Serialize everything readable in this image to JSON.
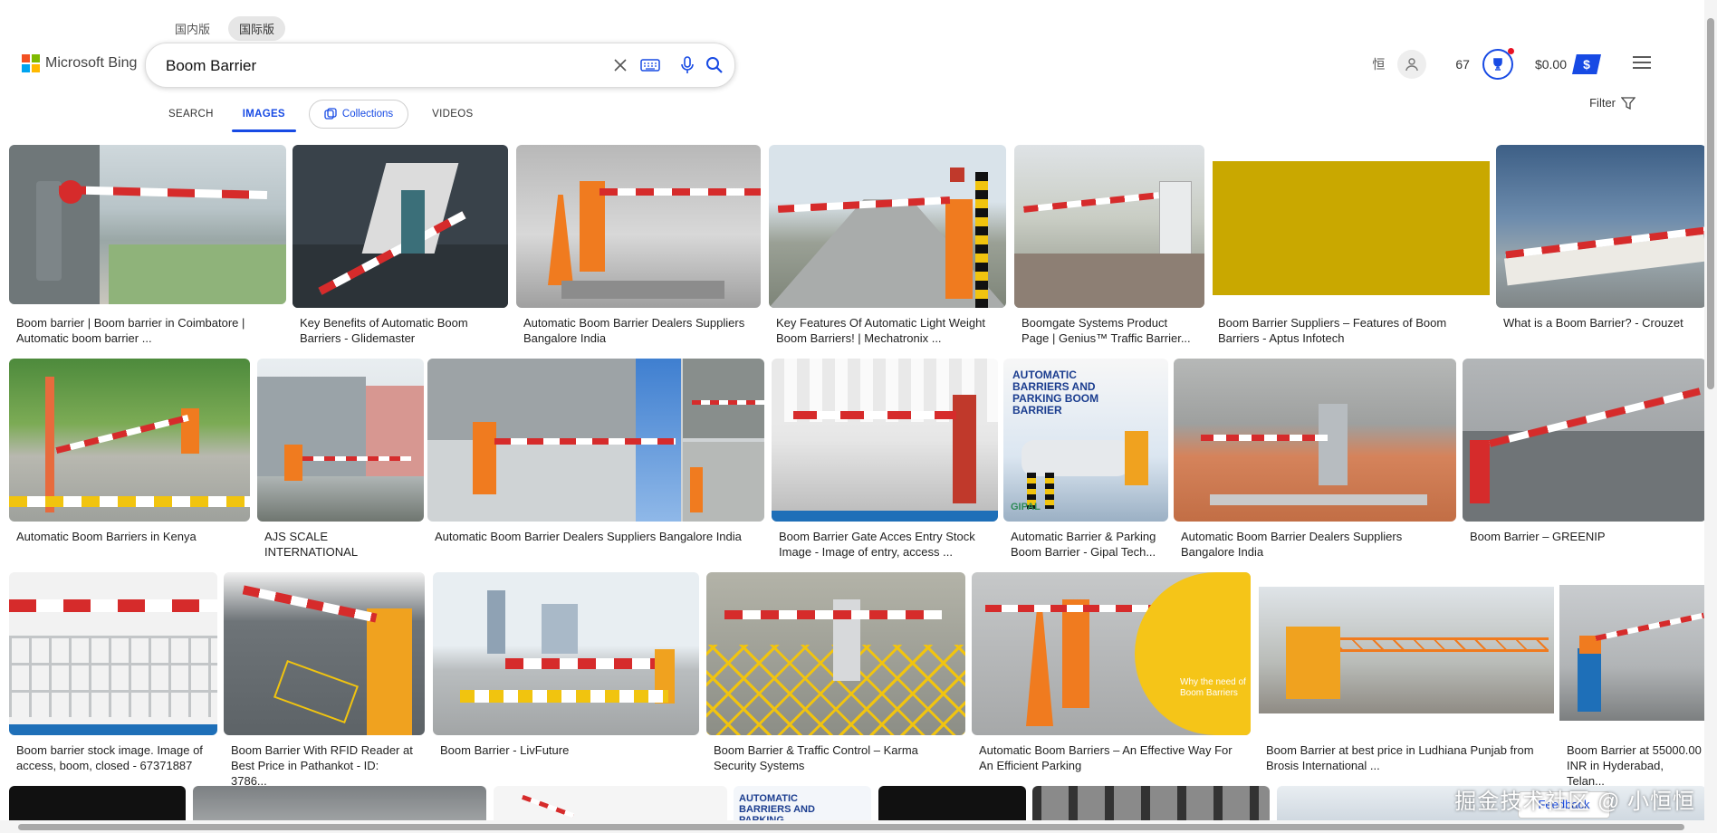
{
  "header": {
    "version_tabs": [
      "国内版",
      "国际版"
    ],
    "logo_text": "Microsoft Bing",
    "search_value": "Boom Barrier",
    "points": "67",
    "balance": "$0.00",
    "filter_label": "Filter"
  },
  "tabs": {
    "search": "SEARCH",
    "images": "IMAGES",
    "collections": "Collections",
    "videos": "VIDEOS"
  },
  "colors": {
    "accent": "#174ae4",
    "logo_red": "#f25022",
    "logo_green": "#7fba00",
    "logo_blue": "#00a4ef",
    "logo_yellow": "#ffb900"
  },
  "results": [
    {
      "caption": "Boom barrier | Boom barrier in Coimbatore | Automatic boom barrier ..."
    },
    {
      "caption": "Key Benefits of Automatic Boom Barriers - Glidemaster"
    },
    {
      "caption": "Automatic Boom Barrier Dealers Suppliers Bangalore India"
    },
    {
      "caption": "Key Features Of Automatic Light Weight Boom Barriers! | Mechatronix ..."
    },
    {
      "caption": "Boomgate Systems Product Page | Genius™ Traffic Barrier..."
    },
    {
      "caption": "Boom Barrier Suppliers – Features of Boom Barriers - Aptus Infotech"
    },
    {
      "caption": "What is a Boom Barrier? - Crouzet"
    },
    {
      "caption": "Automatic Boom Barriers in Kenya"
    },
    {
      "caption": "AJS SCALE INTERNATIONAL"
    },
    {
      "caption": "Automatic Boom Barrier Dealers Suppliers Bangalore India"
    },
    {
      "caption": "Boom Barrier Gate Acces Entry Stock Image - Image of entry, access ..."
    },
    {
      "caption": "Automatic Barrier & Parking Boom Barrier - Gipal Tech..."
    },
    {
      "caption": "Automatic Boom Barrier Dealers Suppliers Bangalore India"
    },
    {
      "caption": "Boom Barrier – GREENIP"
    },
    {
      "caption": "Boom barrier stock image. Image of access, boom, closed - 67371887"
    },
    {
      "caption": "Boom Barrier With RFID Reader at Best Price in Pathankot - ID: 3786..."
    },
    {
      "caption": "Boom Barrier - LivFuture"
    },
    {
      "caption": "Boom Barrier & Traffic Control – Karma Security Systems"
    },
    {
      "caption": "Automatic Boom Barriers – An Effective Way For An Efficient Parking"
    },
    {
      "caption": "Boom Barrier at best price in Ludhiana Punjab from Brosis International ..."
    },
    {
      "caption": "Boom Barrier at 55000.00 INR in Hyderabad, Telan..."
    }
  ],
  "image_texts": {
    "gipal_banner": "AUTOMATIC BARRIERS AND PARKING BOOM BARRIER",
    "gipal_brand": "GIPAL",
    "plush_overlay": "Why the need of Boom Barriers",
    "bottom_banner": "AUTOMATIC BARRIERS AND PARKING"
  },
  "feedback": "Feedback",
  "watermark": "掘金技术社区 @ 小恒恒"
}
